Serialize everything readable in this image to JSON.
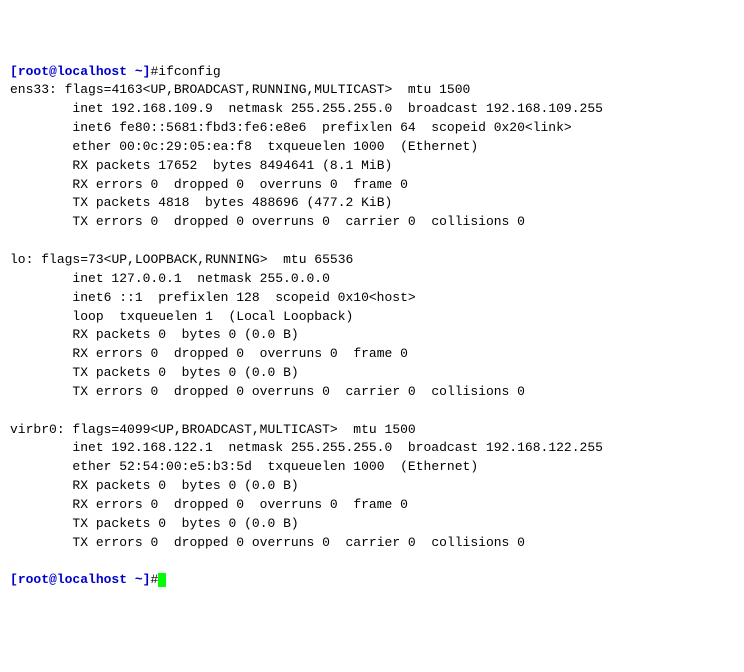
{
  "prompt": {
    "open": "[",
    "user_host": "root@localhost",
    "path": " ~",
    "close": "]",
    "hash": "#"
  },
  "command": "ifconfig",
  "interfaces": [
    {
      "name": "ens33",
      "flags_value": "4163",
      "flags_list": "UP,BROADCAST,RUNNING,MULTICAST",
      "mtu": "1500",
      "inet": "192.168.109.9",
      "netmask": "255.255.255.0",
      "broadcast": "192.168.109.255",
      "inet6": "fe80::5681:fbd3:fe6:e8e6",
      "prefixlen": "64",
      "scopeid": "0x20<link>",
      "mac_label": "ether",
      "mac": "00:0c:29:05:ea:f8",
      "txqueuelen": "1000",
      "link_type": "(Ethernet)",
      "rx_packets": "17652",
      "rx_bytes": "8494641",
      "rx_bytes_h": "(8.1 MiB)",
      "rx_err": "0",
      "rx_drop": "0",
      "rx_over": "0",
      "rx_frame": "0",
      "tx_packets": "4818",
      "tx_bytes": "488696",
      "tx_bytes_h": "(477.2 KiB)",
      "tx_err": "0",
      "tx_drop": "0",
      "tx_over": "0",
      "tx_carrier": "0",
      "tx_coll": "0"
    },
    {
      "name": "lo",
      "flags_value": "73",
      "flags_list": "UP,LOOPBACK,RUNNING",
      "mtu": "65536",
      "inet": "127.0.0.1",
      "netmask": "255.0.0.0",
      "broadcast": "",
      "inet6": "::1",
      "prefixlen": "128",
      "scopeid": "0x10<host>",
      "mac_label": "loop",
      "mac": "",
      "txqueuelen": "1",
      "link_type": "(Local Loopback)",
      "rx_packets": "0",
      "rx_bytes": "0",
      "rx_bytes_h": "(0.0 B)",
      "rx_err": "0",
      "rx_drop": "0",
      "rx_over": "0",
      "rx_frame": "0",
      "tx_packets": "0",
      "tx_bytes": "0",
      "tx_bytes_h": "(0.0 B)",
      "tx_err": "0",
      "tx_drop": "0",
      "tx_over": "0",
      "tx_carrier": "0",
      "tx_coll": "0"
    },
    {
      "name": "virbr0",
      "flags_value": "4099",
      "flags_list": "UP,BROADCAST,MULTICAST",
      "mtu": "1500",
      "inet": "192.168.122.1",
      "netmask": "255.255.255.0",
      "broadcast": "192.168.122.255",
      "inet6": "",
      "prefixlen": "",
      "scopeid": "",
      "mac_label": "ether",
      "mac": "52:54:00:e5:b3:5d",
      "txqueuelen": "1000",
      "link_type": "(Ethernet)",
      "rx_packets": "0",
      "rx_bytes": "0",
      "rx_bytes_h": "(0.0 B)",
      "rx_err": "0",
      "rx_drop": "0",
      "rx_over": "0",
      "rx_frame": "0",
      "tx_packets": "0",
      "tx_bytes": "0",
      "tx_bytes_h": "(0.0 B)",
      "tx_err": "0",
      "tx_drop": "0",
      "tx_over": "0",
      "tx_carrier": "0",
      "tx_coll": "0"
    }
  ]
}
